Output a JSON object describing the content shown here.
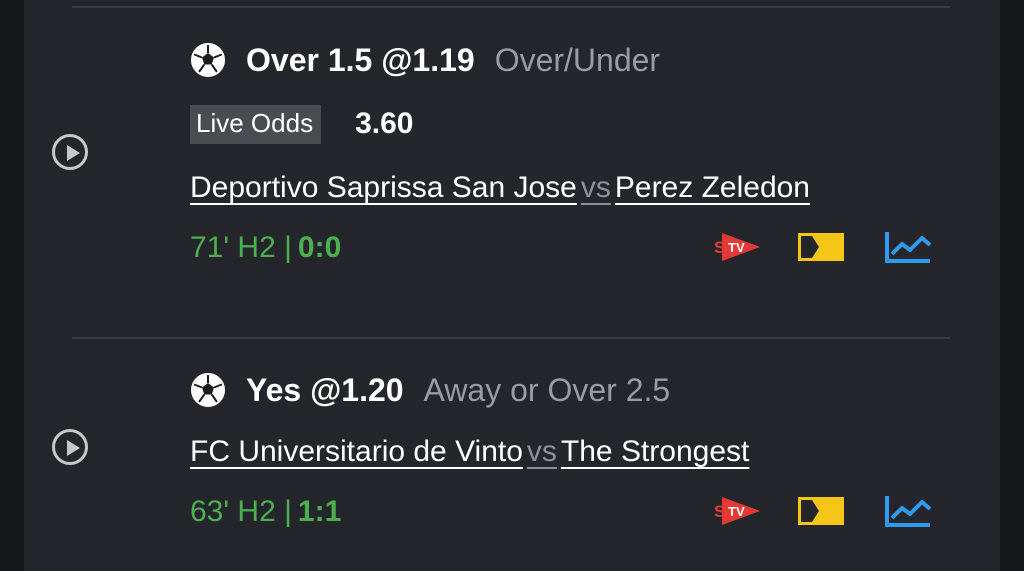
{
  "events": [
    {
      "selection": "Over 1.5 @1.19",
      "market": "Over/Under",
      "live_badge": "Live Odds",
      "live_odds": "3.60",
      "home_team": "Deportivo Saprissa San Jose",
      "vs": "vs",
      "away_team": "Perez Zeledon",
      "time_status": "71' H2 |",
      "score": "0:0"
    },
    {
      "selection": "Yes @1.20",
      "market": "Away or Over 2.5",
      "home_team": "FC Universitario de Vinto",
      "vs": "vs",
      "away_team": "The Strongest",
      "time_status": "63' H2 |",
      "score": "1:1"
    }
  ],
  "icons": {
    "stv": "stv-icon",
    "scoreboard": "scoreboard-icon",
    "stats": "stats-chart-icon",
    "play": "play-icon",
    "sport": "soccer-ball-icon"
  },
  "colors": {
    "live_status": "#4caf50",
    "stv": "#e53935",
    "scoreboard": "#f5c518",
    "stats": "#2f9bf0"
  }
}
